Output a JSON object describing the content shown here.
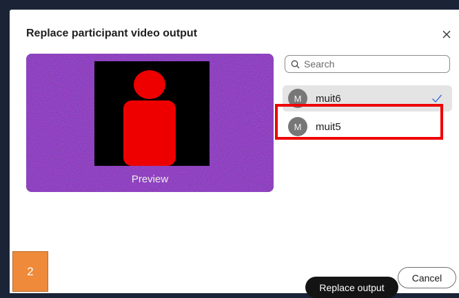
{
  "dialog": {
    "title": "Replace participant video output"
  },
  "preview": {
    "label": "Preview"
  },
  "search": {
    "placeholder": "Search"
  },
  "participants": [
    {
      "initial": "M",
      "name": "muit6",
      "selected": true
    },
    {
      "initial": "M",
      "name": "muit5",
      "selected": false
    }
  ],
  "annotation": {
    "step_number": "2"
  },
  "actions": {
    "primary_label": "Replace output",
    "secondary_label": "Cancel"
  },
  "colors": {
    "primary_button": "#141414",
    "highlight": "#ee0000",
    "badge": "#ee8a3a",
    "avatar_placeholder": "#ee0000",
    "preview_background": "#3a1c5a",
    "checkmark": "#3a6fd8"
  },
  "icons": [
    "close-icon",
    "search-icon",
    "checkmark-icon",
    "person-placeholder-icon"
  ]
}
